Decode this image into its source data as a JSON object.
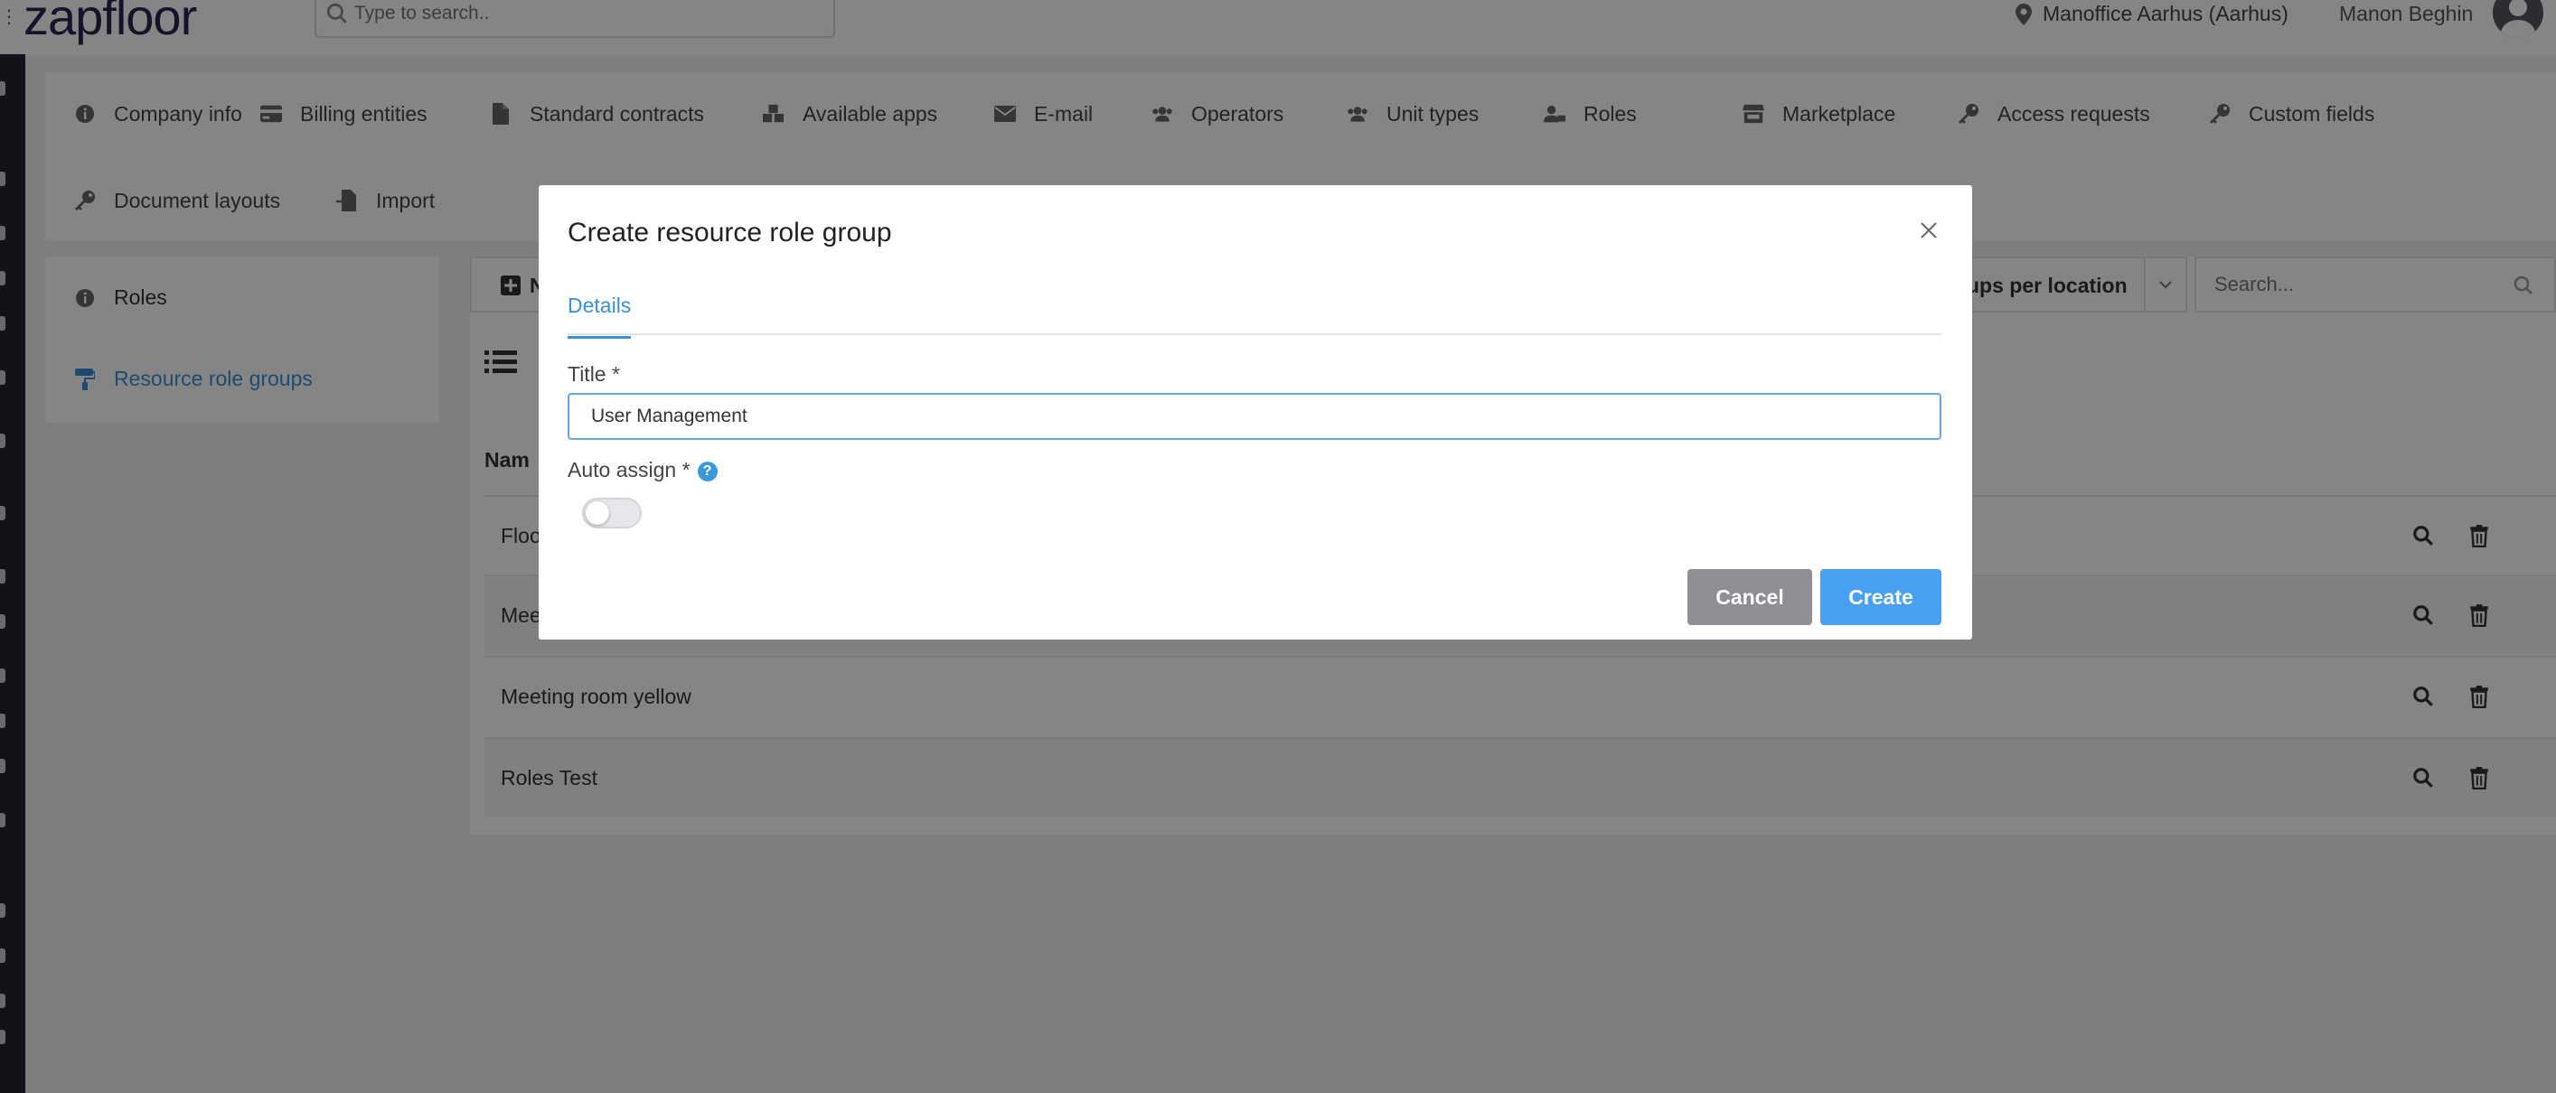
{
  "app": {
    "logo_text": "zapfloor"
  },
  "topbar": {
    "search_placeholder": "Type to search..",
    "location": "Manoffice Aarhus (Aarhus)",
    "user_name": "Manon Beghin"
  },
  "settings_nav": {
    "row1": [
      {
        "label": "Company info",
        "icon": "info-icon"
      },
      {
        "label": "Billing entities",
        "icon": "credit-card-icon"
      },
      {
        "label": "Standard contracts",
        "icon": "file-icon"
      },
      {
        "label": "Available apps",
        "icon": "cubes-icon"
      },
      {
        "label": "E-mail",
        "icon": "envelope-icon"
      },
      {
        "label": "Operators",
        "icon": "users-icon"
      },
      {
        "label": "Unit types",
        "icon": "users-icon"
      },
      {
        "label": "Roles",
        "icon": "user-lock-icon"
      },
      {
        "label": "Marketplace",
        "icon": "store-icon"
      },
      {
        "label": "Access requests",
        "icon": "key-icon"
      },
      {
        "label": "Custom fields",
        "icon": "key-icon"
      }
    ],
    "row2": [
      {
        "label": "Document layouts",
        "icon": "key-icon"
      },
      {
        "label": "Import",
        "icon": "file-import-icon"
      }
    ]
  },
  "submenu": {
    "items": [
      {
        "label": "Roles",
        "icon": "info-icon",
        "active": false
      },
      {
        "label": "Resource role groups",
        "icon": "paint-roller-icon",
        "active": true
      }
    ]
  },
  "main": {
    "new_button_label": "N",
    "group_select_value": "ups per location",
    "search_placeholder": "Search...",
    "table_header_name": "Nam",
    "rows": [
      {
        "name": "Floo"
      },
      {
        "name": "Mee"
      },
      {
        "name": "Meeting room yellow"
      },
      {
        "name": "Roles Test"
      }
    ]
  },
  "modal": {
    "title": "Create resource role group",
    "tab_label": "Details",
    "title_field_label": "Title *",
    "title_field_value": "User Management",
    "auto_assign_label": "Auto assign *",
    "auto_assign_value": false,
    "help_glyph": "?",
    "cancel_label": "Cancel",
    "create_label": "Create"
  },
  "colors": {
    "accent": "#3a8fd6",
    "create_button": "#4aa0f0",
    "cancel_button": "#8e8f95",
    "overlay": "rgba(0,0,0,0.48)",
    "rail": "#24262f"
  }
}
